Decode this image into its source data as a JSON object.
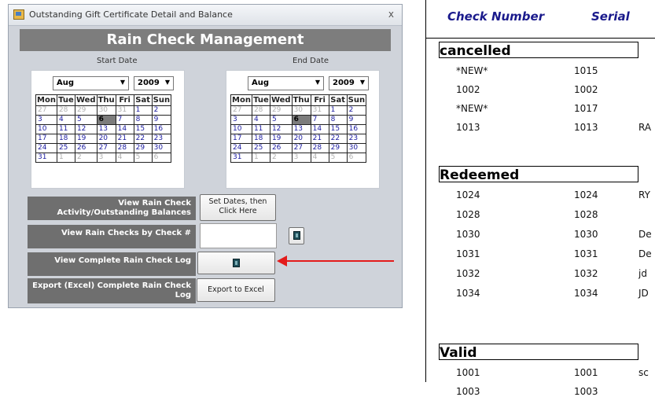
{
  "window": {
    "title": "Outstanding Gift Certificate Detail and Balance",
    "close": "x",
    "header": "Rain Check Management"
  },
  "start": {
    "label": "Start Date",
    "month": "Aug",
    "year": "2009",
    "weekdays": [
      "Mon",
      "Tue",
      "Wed",
      "Thu",
      "Fri",
      "Sat",
      "Sun"
    ],
    "weeks": [
      [
        "27",
        "28",
        "29",
        "30",
        "31",
        "1",
        "2"
      ],
      [
        "3",
        "4",
        "5",
        "6",
        "7",
        "8",
        "9"
      ],
      [
        "10",
        "11",
        "12",
        "13",
        "14",
        "15",
        "16"
      ],
      [
        "17",
        "18",
        "19",
        "20",
        "21",
        "22",
        "23"
      ],
      [
        "24",
        "25",
        "26",
        "27",
        "28",
        "29",
        "30"
      ],
      [
        "31",
        "1",
        "2",
        "3",
        "4",
        "5",
        "6"
      ]
    ],
    "selected": "6"
  },
  "end": {
    "label": "End Date",
    "month": "Aug",
    "year": "2009",
    "weekdays": [
      "Mon",
      "Tue",
      "Wed",
      "Thu",
      "Fri",
      "Sat",
      "Sun"
    ],
    "weeks": [
      [
        "27",
        "28",
        "29",
        "30",
        "31",
        "1",
        "2"
      ],
      [
        "3",
        "4",
        "5",
        "6",
        "7",
        "8",
        "9"
      ],
      [
        "10",
        "11",
        "12",
        "13",
        "14",
        "15",
        "16"
      ],
      [
        "17",
        "18",
        "19",
        "20",
        "21",
        "22",
        "23"
      ],
      [
        "24",
        "25",
        "26",
        "27",
        "28",
        "29",
        "30"
      ],
      [
        "31",
        "1",
        "2",
        "3",
        "4",
        "5",
        "6"
      ]
    ],
    "selected": "6"
  },
  "actions": {
    "view_activity": "View Rain Check Activity/Outstanding Balances",
    "set_dates_button": "Set Dates, then Click Here",
    "view_by_check": "View Rain Checks by Check #",
    "check_number_value": "",
    "view_log": "View Complete Rain Check Log",
    "export_label": "Export (Excel) Complete Rain Check Log",
    "export_button": "Export to Excel"
  },
  "report": {
    "col_check": "Check Number",
    "col_serial": "Serial",
    "sections": [
      {
        "name": "cancelled",
        "rows": [
          {
            "check": "*NEW*",
            "serial": "1015",
            "extra": ""
          },
          {
            "check": "1002",
            "serial": "1002",
            "extra": ""
          },
          {
            "check": "*NEW*",
            "serial": "1017",
            "extra": ""
          },
          {
            "check": "1013",
            "serial": "1013",
            "extra": "RA"
          }
        ]
      },
      {
        "name": "Redeemed",
        "rows": [
          {
            "check": "1024",
            "serial": "1024",
            "extra": "RY"
          },
          {
            "check": "1028",
            "serial": "1028",
            "extra": ""
          },
          {
            "check": "1030",
            "serial": "1030",
            "extra": "De"
          },
          {
            "check": "1031",
            "serial": "1031",
            "extra": "De"
          },
          {
            "check": "1032",
            "serial": "1032",
            "extra": "jd"
          },
          {
            "check": "1034",
            "serial": "1034",
            "extra": "JD"
          }
        ]
      },
      {
        "name": "Valid",
        "rows": [
          {
            "check": "1001",
            "serial": "1001",
            "extra": "sc"
          },
          {
            "check": "1003",
            "serial": "1003",
            "extra": ""
          }
        ]
      }
    ]
  }
}
